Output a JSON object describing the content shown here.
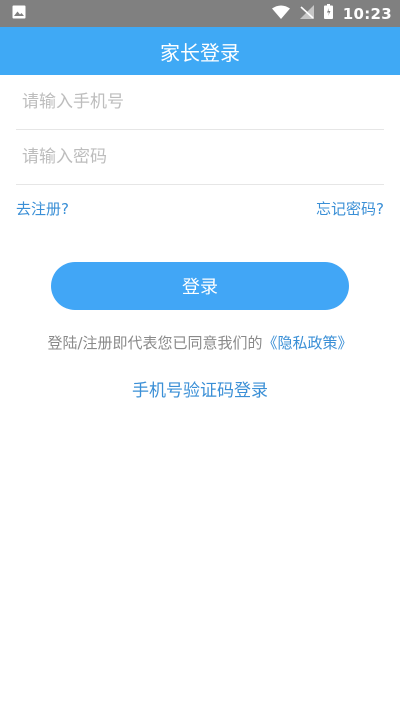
{
  "status_bar": {
    "time": "10:23",
    "icons": [
      "image-icon",
      "wifi-icon",
      "signal-off-icon",
      "battery-icon"
    ]
  },
  "app_bar": {
    "title": "家长登录"
  },
  "form": {
    "phone_placeholder": "请输入手机号",
    "phone_value": "",
    "password_placeholder": "请输入密码",
    "password_value": "",
    "register_label": "去注册?",
    "forgot_label": "忘记密码?",
    "login_label": "登录"
  },
  "agreement": {
    "prefix": "登陆/注册即代表您已同意我们的",
    "policy": "《隐私政策》"
  },
  "sms_login_label": "手机号验证码登录",
  "colors": {
    "status_bar": "#808080",
    "primary": "#3fa9f5",
    "link": "#3a8fd6",
    "placeholder": "#bdbdbd",
    "divider": "#e6e6e6"
  }
}
